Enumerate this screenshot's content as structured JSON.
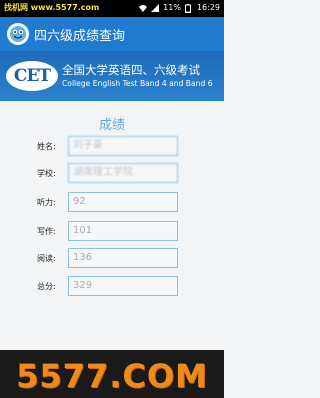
{
  "status_bar": {
    "watermark": "找机网 www.5577.com",
    "battery": "11%",
    "time": "16:29"
  },
  "app_bar": {
    "title": "四六级成绩查询"
  },
  "banner": {
    "logo_text": "CET",
    "title_cn": "全国大学英语四、六级考试",
    "title_en": "College English Test Band 4 and Band 6"
  },
  "result": {
    "section_title": "成绩",
    "rows": [
      {
        "label": "姓名:",
        "value": "刘子豪"
      },
      {
        "label": "学校:",
        "value": "湖南理工学院"
      },
      {
        "label": "听力:",
        "value": "92"
      },
      {
        "label": "写作:",
        "value": "101"
      },
      {
        "label": "阅读:",
        "value": "136"
      },
      {
        "label": "总分:",
        "value": "329"
      }
    ]
  },
  "watermark_bottom": "5577.COM",
  "colors": {
    "app_bar": "#1f7ad0",
    "banner": "#1e6bb8",
    "section_title": "#67a7d9",
    "field_border": "#8ec0e6",
    "watermark": "#f08a1a"
  }
}
